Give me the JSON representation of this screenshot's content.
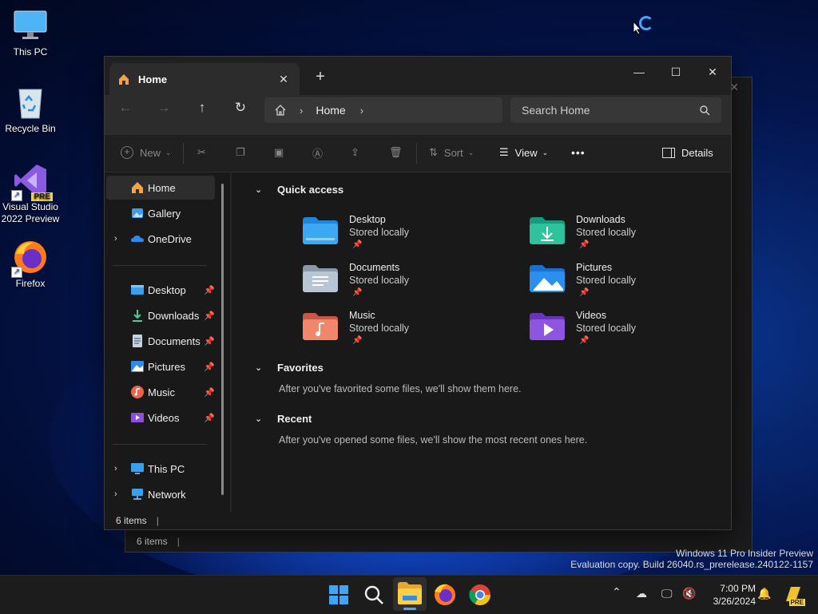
{
  "desktop": {
    "icons": [
      {
        "label": "This PC"
      },
      {
        "label": "Recycle Bin"
      },
      {
        "label": "Visual Studio 2022 Preview",
        "badge": "PRE"
      },
      {
        "label": "Firefox"
      }
    ]
  },
  "background_window": {
    "status": "6 items"
  },
  "window": {
    "tab_title": "Home",
    "new_tab_label": "+",
    "controls": {
      "minimize": "—",
      "maximize": "☐",
      "close": "✕"
    },
    "address": {
      "crumb": "Home"
    },
    "search": {
      "placeholder": "Search Home"
    },
    "commands": {
      "new": "New",
      "sort": "Sort",
      "view": "View",
      "more": "•••",
      "details": "Details"
    },
    "nav": {
      "top": [
        {
          "label": "Home",
          "selected": true
        },
        {
          "label": "Gallery"
        },
        {
          "label": "OneDrive"
        }
      ],
      "pinned": [
        {
          "label": "Desktop"
        },
        {
          "label": "Downloads"
        },
        {
          "label": "Documents"
        },
        {
          "label": "Pictures"
        },
        {
          "label": "Music"
        },
        {
          "label": "Videos"
        }
      ],
      "bottom": [
        {
          "label": "This PC"
        },
        {
          "label": "Network"
        }
      ]
    },
    "sections": {
      "quick_access": "Quick access",
      "favorites": "Favorites",
      "favorites_empty": "After you've favorited some files, we'll show them here.",
      "recent": "Recent",
      "recent_empty": "After you've opened some files, we'll show the most recent ones here."
    },
    "quick_access_items": [
      {
        "name": "Desktop",
        "status": "Stored locally"
      },
      {
        "name": "Downloads",
        "status": "Stored locally"
      },
      {
        "name": "Documents",
        "status": "Stored locally"
      },
      {
        "name": "Pictures",
        "status": "Stored locally"
      },
      {
        "name": "Music",
        "status": "Stored locally"
      },
      {
        "name": "Videos",
        "status": "Stored locally"
      }
    ],
    "status": "6 items"
  },
  "watermark": {
    "line1": "Windows 11 Pro Insider Preview",
    "line2": "Evaluation copy. Build 26040.rs_prerelease.240122-1157"
  },
  "taskbar": {
    "time": "7:00 PM",
    "date": "3/26/2024",
    "tray_badge": "PRE"
  },
  "colors": {
    "accent": "#4aa3ff",
    "window_bg": "#191919"
  }
}
